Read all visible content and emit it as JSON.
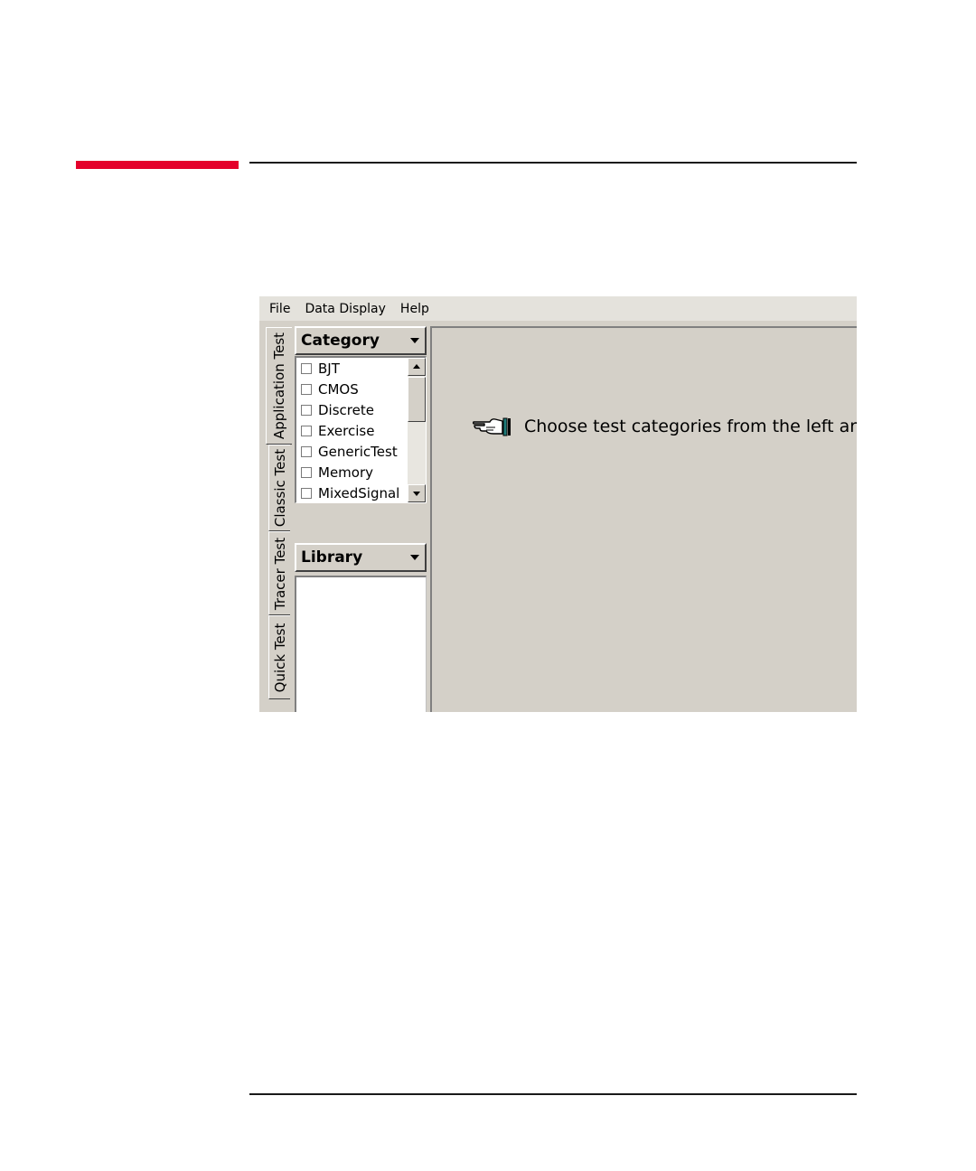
{
  "menu": [
    "File",
    "Data Display",
    "Help"
  ],
  "tabs": [
    {
      "label": "Application Test",
      "active": true
    },
    {
      "label": "Classic Test",
      "active": false
    },
    {
      "label": "Tracer Test",
      "active": false
    },
    {
      "label": "Quick Test",
      "active": false
    }
  ],
  "category_panel": {
    "header": "Category",
    "items": [
      "BJT",
      "CMOS",
      "Discrete",
      "Exercise",
      "GenericTest",
      "Memory",
      "MixedSignal"
    ]
  },
  "library_panel": {
    "header": "Library"
  },
  "main": {
    "hint": "Choose test categories from the left area."
  },
  "colors": {
    "accent_bar": "#e4002b",
    "window_bg": "#d4d0c8"
  }
}
